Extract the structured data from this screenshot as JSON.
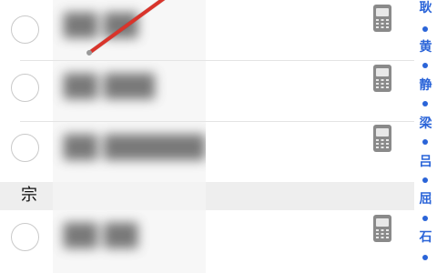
{
  "contacts": [
    {
      "name": "██ ██"
    },
    {
      "name": "██ ███"
    },
    {
      "name": "██ ██████"
    },
    {
      "name": "██ ██"
    }
  ],
  "section_header": {
    "letter": "宗"
  },
  "index_bar": {
    "letters": [
      "耿",
      "黄",
      "静",
      "梁",
      "吕",
      "屈",
      "石"
    ],
    "color": "#2a64d8"
  },
  "icons": {
    "row_action": "mobile-phone-icon",
    "row_select": "radio-circle-icon",
    "index_separator": "dot-icon"
  },
  "colors": {
    "background": "#ffffff",
    "section_header_bg": "#eeeeee",
    "divider": "#e4e4e4",
    "radio_border": "#c9c9c9",
    "index_text": "#2a64d8",
    "stylus": "#d9342b"
  }
}
